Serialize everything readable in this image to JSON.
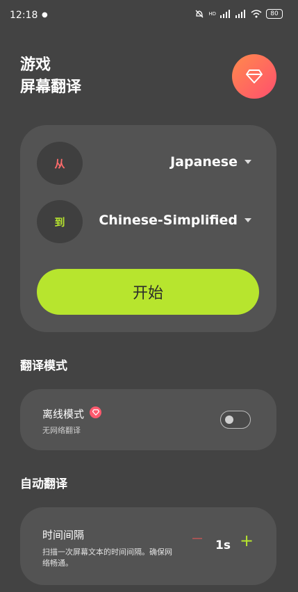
{
  "status": {
    "time": "12:18",
    "battery": "80",
    "hd": "HD"
  },
  "header": {
    "title_line1": "游戏",
    "title_line2": "屏幕翻译",
    "pro_icon": "gem-icon"
  },
  "language": {
    "from_label": "从",
    "from_value": "Japanese",
    "to_label": "到",
    "to_value": "Chinese-Simplified",
    "start_label": "开始"
  },
  "mode_section": {
    "title": "翻译模式",
    "offline_label": "离线模式",
    "offline_sub": "无网络翻译",
    "offline_enabled": false
  },
  "auto_section": {
    "title": "自动翻译",
    "interval_label": "时间间隔",
    "interval_desc": "扫描一次屏幕文本的时间间隔。确保网络畅通。",
    "interval_value": "1s"
  },
  "colors": {
    "accent": "#b7e52e",
    "from_color": "#ff6b6b",
    "bg": "#434343",
    "card": "#535353"
  }
}
